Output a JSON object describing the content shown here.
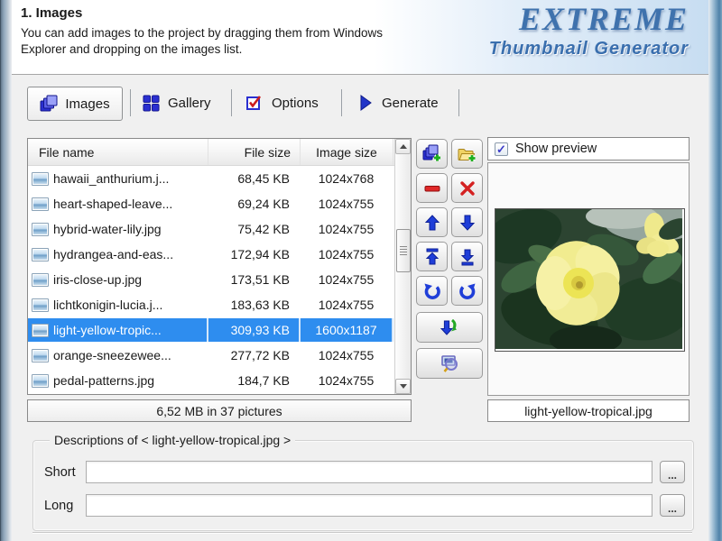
{
  "header": {
    "title": "1. Images",
    "description_line1": "You can add images to the project by dragging them from Windows",
    "description_line2": "Explorer and dropping on the images list.",
    "logo_line1": "EXTREME",
    "logo_line2": "Thumbnail Generator"
  },
  "tabs": {
    "items": [
      {
        "label": "Images",
        "icon": "images-icon",
        "selected": true
      },
      {
        "label": "Gallery",
        "icon": "gallery-icon",
        "selected": false
      },
      {
        "label": "Options",
        "icon": "options-icon",
        "selected": false
      },
      {
        "label": "Generate",
        "icon": "generate-icon",
        "selected": false
      }
    ]
  },
  "file_list": {
    "columns": {
      "name": "File name",
      "size": "File size",
      "dimensions": "Image size"
    },
    "rows": [
      {
        "name": "hawaii_anthurium.j...",
        "size": "68,45 KB",
        "dimensions": "1024x768",
        "selected": false
      },
      {
        "name": "heart-shaped-leave...",
        "size": "69,24 KB",
        "dimensions": "1024x755",
        "selected": false
      },
      {
        "name": "hybrid-water-lily.jpg",
        "size": "75,42 KB",
        "dimensions": "1024x755",
        "selected": false
      },
      {
        "name": "hydrangea-and-eas...",
        "size": "172,94 KB",
        "dimensions": "1024x755",
        "selected": false
      },
      {
        "name": "iris-close-up.jpg",
        "size": "173,51 KB",
        "dimensions": "1024x755",
        "selected": false
      },
      {
        "name": "lichtkonigin-lucia.j...",
        "size": "183,63 KB",
        "dimensions": "1024x755",
        "selected": false
      },
      {
        "name": "light-yellow-tropic...",
        "size": "309,93 KB",
        "dimensions": "1600x1187",
        "selected": true
      },
      {
        "name": "orange-sneezewee...",
        "size": "277,72 KB",
        "dimensions": "1024x755",
        "selected": false
      },
      {
        "name": "pedal-patterns.jpg",
        "size": "184,7 KB",
        "dimensions": "1024x755",
        "selected": false
      }
    ],
    "status_bar": "6,52 MB in 37 pictures"
  },
  "toolbar": {
    "buttons": [
      "add-images",
      "add-folder",
      "remove-selected",
      "delete-all",
      "move-up",
      "move-down",
      "move-to-top",
      "move-to-bottom",
      "rotate-left",
      "rotate-right",
      "move-all-down",
      "preview-image"
    ]
  },
  "preview": {
    "show_preview_label": "Show preview",
    "checkbox_checked": true,
    "selected_filename": "light-yellow-tropical.jpg"
  },
  "descriptions": {
    "legend": "Descriptions of < light-yellow-tropical.jpg >",
    "short_label": "Short",
    "long_label": "Long",
    "short_value": "",
    "long_value": "",
    "browse_button_label": "..."
  },
  "icons": {
    "checkmark": "✓"
  },
  "colors": {
    "selection_blue": "#2e8def",
    "icon_blue": "#2135c8",
    "logo_blue": "#3a6fae",
    "selected_dims_bg": "#2e8def"
  }
}
